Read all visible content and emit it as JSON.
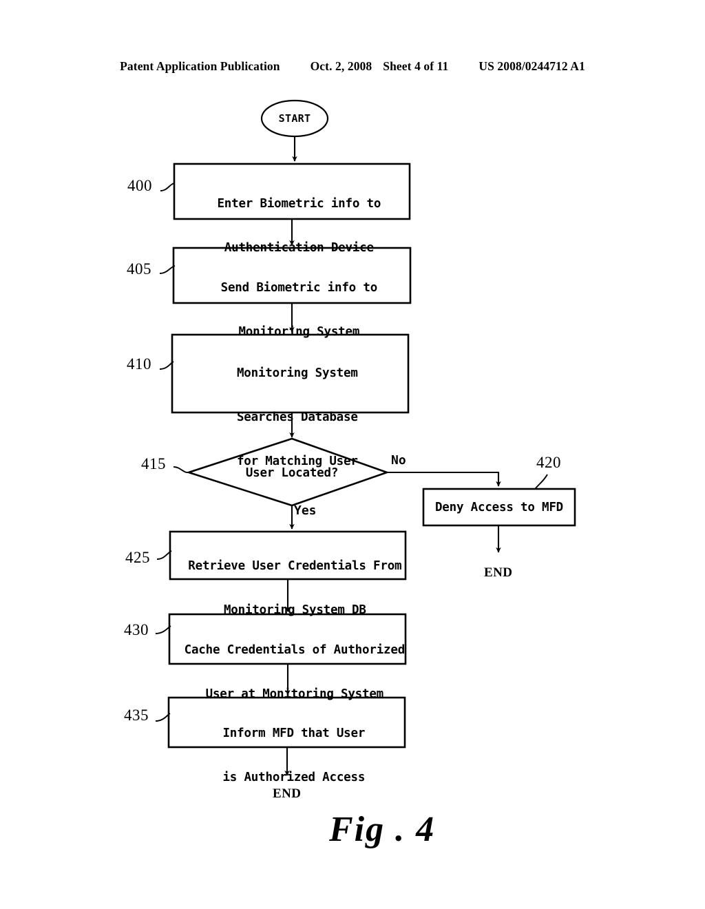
{
  "header": {
    "publication": "Patent Application Publication",
    "date": "Oct. 2, 2008",
    "sheet": "Sheet 4 of 11",
    "patent_number": "US 2008/0244712 A1"
  },
  "figure": {
    "caption": "Fig . 4"
  },
  "chart_data": {
    "type": "diagram",
    "title": "Fig . 4",
    "subtype": "flowchart",
    "nodes": [
      {
        "id": "start",
        "shape": "oval",
        "label": "START",
        "ref": null
      },
      {
        "id": "n400",
        "shape": "process",
        "label": "Enter Biometric info to\nAuthentication Device",
        "ref": "400"
      },
      {
        "id": "n405",
        "shape": "process",
        "label": "Send Biometric info to\nMonitoring System",
        "ref": "405"
      },
      {
        "id": "n410",
        "shape": "process",
        "label": "Monitoring System\nSearches Database\nfor Matching User",
        "ref": "410"
      },
      {
        "id": "n415",
        "shape": "decision",
        "label": "User Located?",
        "ref": "415"
      },
      {
        "id": "n420",
        "shape": "process",
        "label": "Deny Access to MFD",
        "ref": "420"
      },
      {
        "id": "n425",
        "shape": "process",
        "label": "Retrieve User Credentials From\nMonitoring System DB",
        "ref": "425"
      },
      {
        "id": "n430",
        "shape": "process",
        "label": "Cache Credentials of Authorized\nUser at Monitoring System",
        "ref": "430"
      },
      {
        "id": "n435",
        "shape": "process",
        "label": "Inform MFD that User\nis Authorized Access",
        "ref": "435"
      },
      {
        "id": "end_right",
        "shape": "terminal",
        "label": "END",
        "ref": null
      },
      {
        "id": "end_bottom",
        "shape": "terminal",
        "label": "END",
        "ref": null
      }
    ],
    "edges": [
      {
        "from": "start",
        "to": "n400",
        "label": ""
      },
      {
        "from": "n400",
        "to": "n405",
        "label": ""
      },
      {
        "from": "n405",
        "to": "n410",
        "label": ""
      },
      {
        "from": "n410",
        "to": "n415",
        "label": ""
      },
      {
        "from": "n415",
        "to": "n420",
        "label": "No"
      },
      {
        "from": "n415",
        "to": "n425",
        "label": "Yes"
      },
      {
        "from": "n420",
        "to": "end_right",
        "label": ""
      },
      {
        "from": "n425",
        "to": "n430",
        "label": ""
      },
      {
        "from": "n430",
        "to": "n435",
        "label": ""
      },
      {
        "from": "n435",
        "to": "end_bottom",
        "label": ""
      }
    ],
    "colors": {
      "stroke": "#000000",
      "fill": "#ffffff",
      "text": "#000000"
    }
  },
  "nodes": {
    "start": {
      "label": "START"
    },
    "n400": {
      "ref": "400",
      "line1": "Enter Biometric info to",
      "line2": "Authentication Device"
    },
    "n405": {
      "ref": "405",
      "line1": "Send Biometric info to",
      "line2": "Monitoring System"
    },
    "n410": {
      "ref": "410",
      "line1": "Monitoring System",
      "line2": "Searches Database",
      "line3": "for Matching User"
    },
    "n415": {
      "ref": "415",
      "label": "User Located?"
    },
    "n420": {
      "ref": "420",
      "label": "Deny Access to MFD"
    },
    "n425": {
      "ref": "425",
      "line1": "Retrieve User Credentials From",
      "line2": "Monitoring System DB"
    },
    "n430": {
      "ref": "430",
      "line1": "Cache Credentials of Authorized",
      "line2": "User at Monitoring System"
    },
    "n435": {
      "ref": "435",
      "line1": "Inform MFD that User",
      "line2": "is Authorized Access"
    },
    "end_right": {
      "label": "END"
    },
    "end_bottom": {
      "label": "END"
    }
  },
  "branches": {
    "no": "No",
    "yes": "Yes"
  }
}
